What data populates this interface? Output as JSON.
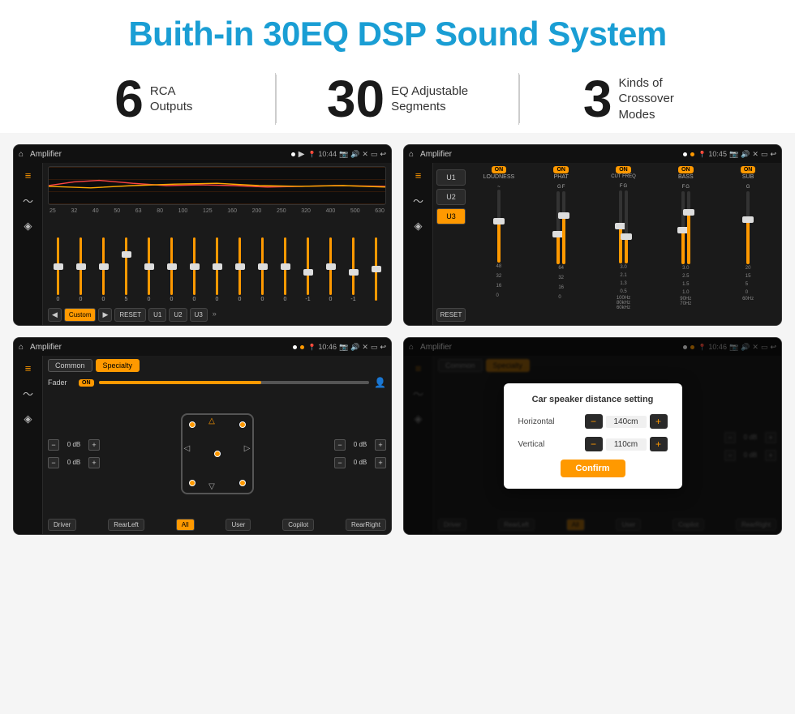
{
  "header": {
    "title": "Buith-in 30EQ DSP Sound System"
  },
  "stats": [
    {
      "number": "6",
      "label_line1": "RCA",
      "label_line2": "Outputs"
    },
    {
      "number": "30",
      "label_line1": "EQ Adjustable",
      "label_line2": "Segments"
    },
    {
      "number": "3",
      "label_line1": "Kinds of",
      "label_line2": "Crossover Modes"
    }
  ],
  "screens": [
    {
      "bar_title": "Amplifier",
      "bar_time": "10:44",
      "type": "eq"
    },
    {
      "bar_title": "Amplifier",
      "bar_time": "10:45",
      "type": "crossover"
    },
    {
      "bar_title": "Amplifier",
      "bar_time": "10:46",
      "type": "fader"
    },
    {
      "bar_title": "Amplifier",
      "bar_time": "10:46",
      "type": "distance"
    }
  ],
  "eq": {
    "freq_labels": [
      "25",
      "32",
      "40",
      "50",
      "63",
      "80",
      "100",
      "125",
      "160",
      "200",
      "250",
      "320",
      "400",
      "500",
      "630"
    ],
    "values": [
      "0",
      "0",
      "0",
      "5",
      "0",
      "0",
      "0",
      "0",
      "0",
      "0",
      "0",
      "-1",
      "0",
      "-1",
      ""
    ],
    "preset": "Custom",
    "buttons": [
      "RESET",
      "U1",
      "U2",
      "U3"
    ]
  },
  "crossover": {
    "presets": [
      "U1",
      "U2",
      "U3"
    ],
    "channels": [
      {
        "name": "LOUDNESS",
        "toggle": "ON"
      },
      {
        "name": "PHAT",
        "toggle": "ON"
      },
      {
        "name": "CUT FREQ",
        "toggle": "ON"
      },
      {
        "name": "BASS",
        "toggle": "ON"
      },
      {
        "name": "SUB",
        "toggle": "ON"
      }
    ],
    "reset_label": "RESET"
  },
  "fader": {
    "tabs": [
      "Common",
      "Specialty"
    ],
    "active_tab": "Specialty",
    "fader_label": "Fader",
    "toggle": "ON",
    "db_values": [
      "0 dB",
      "0 dB",
      "0 dB",
      "0 dB"
    ],
    "btns": [
      "Driver",
      "RearLeft",
      "All",
      "User",
      "Copilot",
      "RearRight"
    ]
  },
  "distance_modal": {
    "title": "Car speaker distance setting",
    "horizontal_label": "Horizontal",
    "horizontal_value": "140cm",
    "vertical_label": "Vertical",
    "vertical_value": "110cm",
    "confirm_label": "Confirm"
  }
}
